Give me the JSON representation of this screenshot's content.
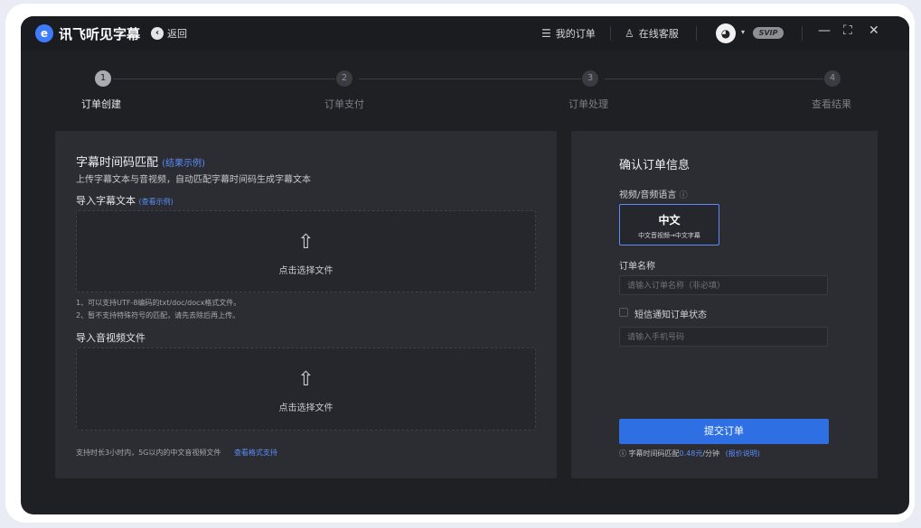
{
  "titlebar": {
    "logo_glyph": "e",
    "app_title": "讯飞听见字幕",
    "back_glyph": "‹",
    "back_label": "返回",
    "my_orders_icon": "☰",
    "my_orders_label": "我的订单",
    "support_icon": "♙",
    "support_label": "在线客服",
    "avatar_glyph": "◕",
    "caret": "▾",
    "badge": "SVIP",
    "minimize": "—",
    "maximize": "⛶",
    "close": "✕"
  },
  "steps": [
    {
      "num": "1",
      "label": "订单创建",
      "active": true
    },
    {
      "num": "2",
      "label": "订单支付",
      "active": false
    },
    {
      "num": "3",
      "label": "订单处理",
      "active": false
    },
    {
      "num": "4",
      "label": "查看结果",
      "active": false
    }
  ],
  "left": {
    "title": "字幕时间码匹配",
    "title_link": "(结果示例)",
    "subtitle": "上传字幕文本与音视频，自动匹配字幕时间码生成字幕文本",
    "import_text_label": "导入字幕文本",
    "import_text_link": "(查看示例)",
    "upload_icon": "⇧",
    "upload_text": "点击选择文件",
    "notes": [
      "1、可以支持UTF-8编码的txt/doc/docx格式文件。",
      "2、暂不支持特殊符号的匹配，请先去除后再上传。"
    ],
    "import_av_label": "导入音视频文件",
    "upload_av_text": "点击选择文件",
    "support_note": "支持时长3小时内，5G以内的中文音视频文件",
    "format_link": "查看格式支持"
  },
  "right": {
    "title": "确认订单信息",
    "lang_label": "视频/音频语言",
    "help_icon": "ⓘ",
    "lang_main": "中文",
    "lang_sub": "中文音视频→中文字幕",
    "order_name_label": "订单名称",
    "order_name_placeholder": "请输入订单名称（非必填）",
    "sms_label": "短信通知订单状态",
    "phone_placeholder": "请输入手机号码",
    "submit_label": "提交订单",
    "price_icon": "ⓘ",
    "price_prefix": "字幕时间码匹配",
    "price_value": "0.48元",
    "price_suffix": "/分钟",
    "price_link": "(报价说明)"
  },
  "colors": {
    "accent": "#2e6fe3",
    "link": "#5b8cf7",
    "panel": "#2b2d33",
    "background": "#1f2024"
  }
}
